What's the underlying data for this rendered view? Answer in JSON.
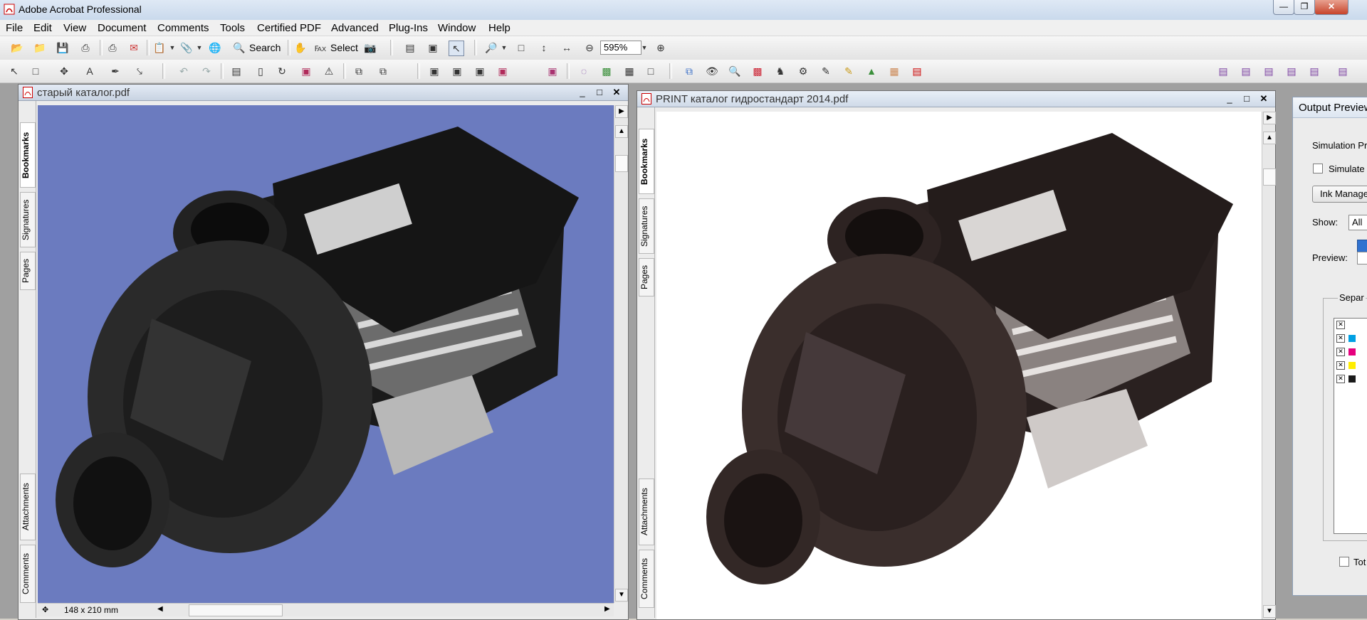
{
  "window": {
    "title": "Adobe Acrobat Professional"
  },
  "menu": [
    "File",
    "Edit",
    "View",
    "Document",
    "Comments",
    "Tools",
    "Certified PDF",
    "Advanced",
    "Plug-Ins",
    "Window",
    "Help"
  ],
  "toolbar": {
    "search_label": "Search",
    "select_label": "Select",
    "zoom_value": "595%"
  },
  "doc_left": {
    "title": "старый каталог.pdf",
    "page_size": "148 x 210 mm",
    "tabs": [
      "Bookmarks",
      "Signatures",
      "Pages",
      "Attachments",
      "Comments"
    ],
    "background_color": "#6b7bbf"
  },
  "doc_right": {
    "title": "PRINT каталог гидростандарт 2014.pdf",
    "tabs": [
      "Bookmarks",
      "Signatures",
      "Pages",
      "Attachments",
      "Comments"
    ],
    "background_color": "#ffffff"
  },
  "output_preview": {
    "title": "Output Preview",
    "simulation_profile_label": "Simulation Pr",
    "simulate_label": "Simulate",
    "ink_manager_label": "Ink Manage",
    "show_label": "Show:",
    "show_value": "All",
    "preview_label": "Preview:",
    "separations_label": "Separ",
    "total_label": "Tot",
    "separations": [
      {
        "color": ""
      },
      {
        "color": "#00a0e3"
      },
      {
        "color": "#e6007e"
      },
      {
        "color": "#ffed00"
      },
      {
        "color": "#1a1a1a"
      }
    ]
  }
}
